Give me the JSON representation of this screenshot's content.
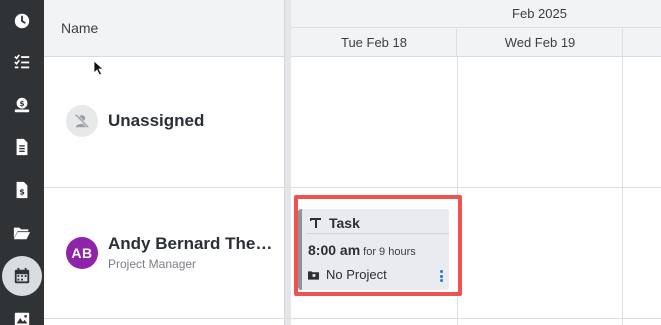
{
  "sidebar": {
    "items": [
      {
        "icon": "clock-icon"
      },
      {
        "icon": "checklist-icon"
      },
      {
        "icon": "money-stack-icon"
      },
      {
        "icon": "document-icon"
      },
      {
        "icon": "invoice-dollar-icon"
      },
      {
        "icon": "folder-open-icon"
      },
      {
        "icon": "calendar-icon",
        "active": true
      },
      {
        "icon": "image-icon"
      }
    ]
  },
  "schedule": {
    "name_column_header": "Name",
    "month": "Feb 2025",
    "days": [
      "Tue Feb 18",
      "Wed Feb 19"
    ],
    "rows": [
      {
        "name": "Unassigned",
        "avatar_icon": "unassigned-user-icon"
      },
      {
        "name": "Andy Bernard The…",
        "initials": "AB",
        "role": "Project Manager",
        "avatar_color": "#8e24aa"
      }
    ],
    "task": {
      "title": "Task",
      "time": "8:00 am",
      "duration": "for 9 hours",
      "project": "No Project"
    }
  },
  "colors": {
    "sidebar_bg": "#2f3336",
    "highlight": "#ef5350",
    "menu_dots": "#1e78d7"
  }
}
